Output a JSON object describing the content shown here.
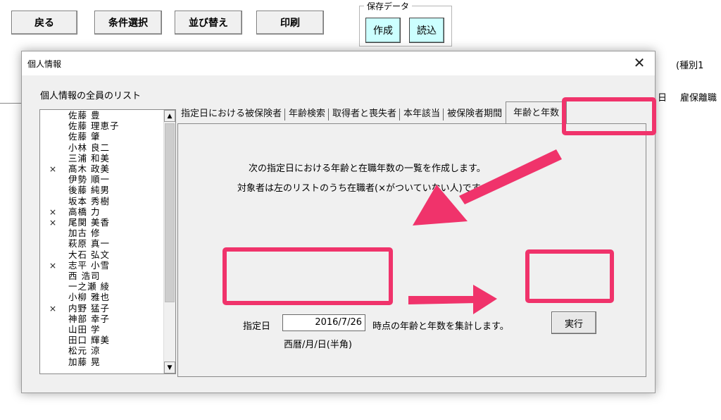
{
  "toolbar": {
    "back_label": "戻る",
    "condition_label": "条件選択",
    "sort_label": "並び替え",
    "print_label": "印刷"
  },
  "save_data": {
    "legend": "保存データ",
    "create_label": "作成",
    "load_label": "読込"
  },
  "background": {
    "type_label": "(種別1",
    "col_day": "日",
    "col_insurance": "雇保離職"
  },
  "dialog": {
    "title": "個人情報",
    "close_glyph": "✕",
    "list_label": "個人情報の全員のリスト",
    "people": [
      {
        "mark": "",
        "name": "佐藤 豊"
      },
      {
        "mark": "",
        "name": "佐藤 理恵子"
      },
      {
        "mark": "",
        "name": "佐藤 肇"
      },
      {
        "mark": "",
        "name": "小林 良二"
      },
      {
        "mark": "",
        "name": "三浦 和美"
      },
      {
        "mark": "×",
        "name": "髙木 政美"
      },
      {
        "mark": "",
        "name": "伊勢 順一"
      },
      {
        "mark": "",
        "name": "後藤 純男"
      },
      {
        "mark": "",
        "name": "坂本 秀樹"
      },
      {
        "mark": "×",
        "name": "高橋 力"
      },
      {
        "mark": "×",
        "name": "尾関 美香"
      },
      {
        "mark": "",
        "name": "加古 修"
      },
      {
        "mark": "",
        "name": "萩原 真一"
      },
      {
        "mark": "",
        "name": "大石 弘文"
      },
      {
        "mark": "×",
        "name": "志平 小雪"
      },
      {
        "mark": "",
        "name": "西 浩司"
      },
      {
        "mark": "",
        "name": "一之瀬 綾"
      },
      {
        "mark": "",
        "name": "小柳 雅也"
      },
      {
        "mark": "×",
        "name": "内野 猛子"
      },
      {
        "mark": "",
        "name": "神部 幸子"
      },
      {
        "mark": "",
        "name": "山田 学"
      },
      {
        "mark": "",
        "name": "田口 輝美"
      },
      {
        "mark": "",
        "name": "松元 涼"
      },
      {
        "mark": "",
        "name": "加藤 晃"
      }
    ],
    "tabs": [
      {
        "label": "指定日における被保険者",
        "active": false
      },
      {
        "label": "年齢検索",
        "active": false
      },
      {
        "label": "取得者と喪失者",
        "active": false
      },
      {
        "label": "本年該当",
        "active": false
      },
      {
        "label": "被保険者期間",
        "active": false
      },
      {
        "label": "年齢と年数",
        "active": true
      }
    ],
    "panel": {
      "line1": "次の指定日における年齢と在職年数の一覧を作成します。",
      "line2": "対象者は左のリストのうち在職者(×がついていない人)です。",
      "date_label": "指定日",
      "date_value": "2016/7/26",
      "date_note": "時点の年齢と年数を集計します。",
      "format_note": "西暦/月/日(半角)",
      "run_label": "実行"
    }
  },
  "colors": {
    "highlight": "#f0336b",
    "save_button": "#ccffff",
    "dialog_bg": "#f0f0f0"
  }
}
